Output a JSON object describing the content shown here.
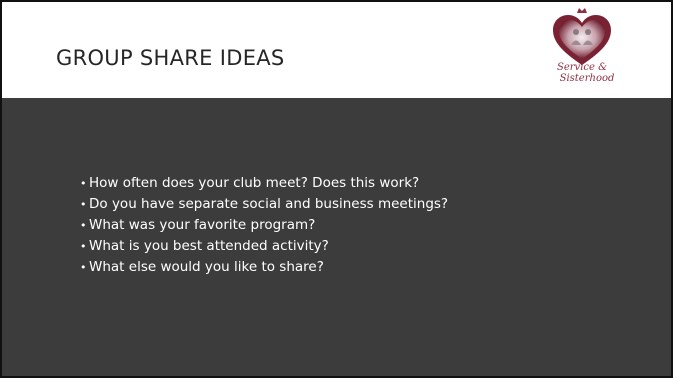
{
  "slide": {
    "title": "GROUP SHARE IDEAS",
    "logo": {
      "icon": "heart-logo-icon",
      "line1": "Service &",
      "line2": "Sisterhood"
    },
    "bullets": [
      "How often does your club meet?  Does this work?",
      "Do you have separate social and business meetings?",
      "What was your favorite program?",
      "What is you best attended activity?",
      "What else would you like to share?"
    ],
    "colors": {
      "header_bg": "#ffffff",
      "body_bg": "#3c3c3c",
      "title_text": "#262626",
      "bullet_text": "#ffffff",
      "logo_accent": "#8e2f42"
    }
  }
}
